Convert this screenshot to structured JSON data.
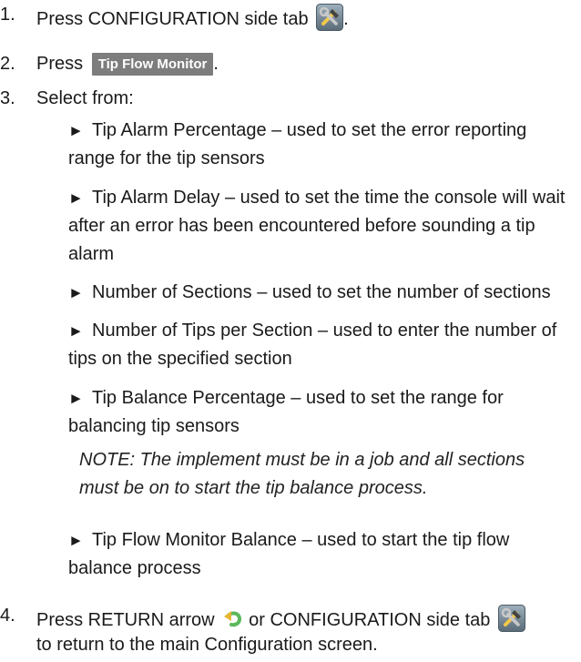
{
  "steps": [
    {
      "num": "1.",
      "before": "Press CONFIGURATION side tab",
      "after": "."
    },
    {
      "num": "2.",
      "before": "Press",
      "button": "Tip Flow Monitor",
      "after": "."
    },
    {
      "num": "3.",
      "text": "Select from:"
    },
    {
      "num": "4.",
      "before": "Press RETURN arrow",
      "middle": "or CONFIGURATION side tab",
      "line2": "to return to the main Configuration screen."
    }
  ],
  "options": [
    {
      "line1": "Tip Alarm Percentage – used to set the error reporting",
      "line2": "range for the tip sensors"
    },
    {
      "line1": "Tip Alarm Delay – used to set the time the console will wait",
      "line2": "after an error has been encountered before sounding a tip",
      "line3": "alarm"
    },
    {
      "line1": "Number of Sections – used to set the number of sections"
    },
    {
      "line1": "Number of Tips per Section – used to enter the number of",
      "line2": "tips on the specified section"
    },
    {
      "line1": "Tip Balance Percentage – used to set the range for",
      "line2": "balancing tip sensors"
    },
    {
      "line1": "Tip Flow Monitor Balance – used to start the tip flow",
      "line2": "balance process"
    }
  ],
  "note": {
    "line1": "NOTE: The implement must be in a job and all sections",
    "line2": "must be on to start the tip balance process."
  },
  "icons": {
    "configuration_tab": "hammer-wrench-icon",
    "return_arrow": "return-arrow-icon",
    "bullet": "►"
  }
}
